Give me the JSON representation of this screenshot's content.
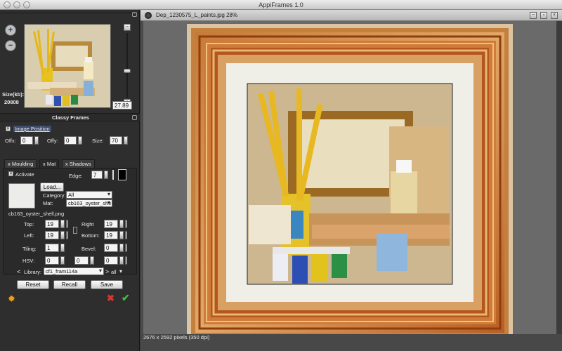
{
  "window": {
    "title": "AppiFrames 1.0"
  },
  "navigator": {
    "size_label": "Size(kb):",
    "size_value": "20808",
    "zoom_value": "27.89"
  },
  "panel": {
    "section_title": "Classy Frames",
    "image_position_label": "Image Position",
    "offx_label": "Offx:",
    "offx_value": "0",
    "offy_label": "Offy:",
    "offy_value": "0",
    "size_label": "Size:",
    "size_value": "70",
    "tabs": [
      "x Moulding",
      "x Mat",
      "x Shadows"
    ],
    "activate_label": "Activate",
    "edge_label": "Edge:",
    "edge_value": "7",
    "load_button": "Load...",
    "category_label": "Category:",
    "category_value": "All",
    "mat_label": "Mat:",
    "mat_value": "cb163_oyster_she",
    "mat_filename": "cb163_oyster_shell.png",
    "top_label": "Top:",
    "top_value": "19",
    "right_label": "Right",
    "right_value": "19",
    "left_label": "Left:",
    "left_value": "19",
    "bottom_label": "Bottom:",
    "bottom_value": "19",
    "tiling_label": "Tiling:",
    "tiling_value": "1",
    "bevel_label": "Bevel:",
    "bevel_value": "0",
    "hsv_label": "HSV:",
    "hsv_values": [
      "0",
      "0",
      "0"
    ],
    "library_label": "Library:",
    "library_value": "cf1_fram114a",
    "library_scope": "all",
    "reset_button": "Reset",
    "recall_button": "Recall",
    "save_button": "Save"
  },
  "image": {
    "filename_zoom": "Dep_1230575_L_paints.jpg 28%",
    "status": "2676 x 2592 pixels (350 dpi)"
  },
  "colors": {
    "panel_bg": "#2e2e2e",
    "frame_orange": "#c9692a",
    "frame_gold": "#d6a55c",
    "mat": "#efefe8"
  }
}
